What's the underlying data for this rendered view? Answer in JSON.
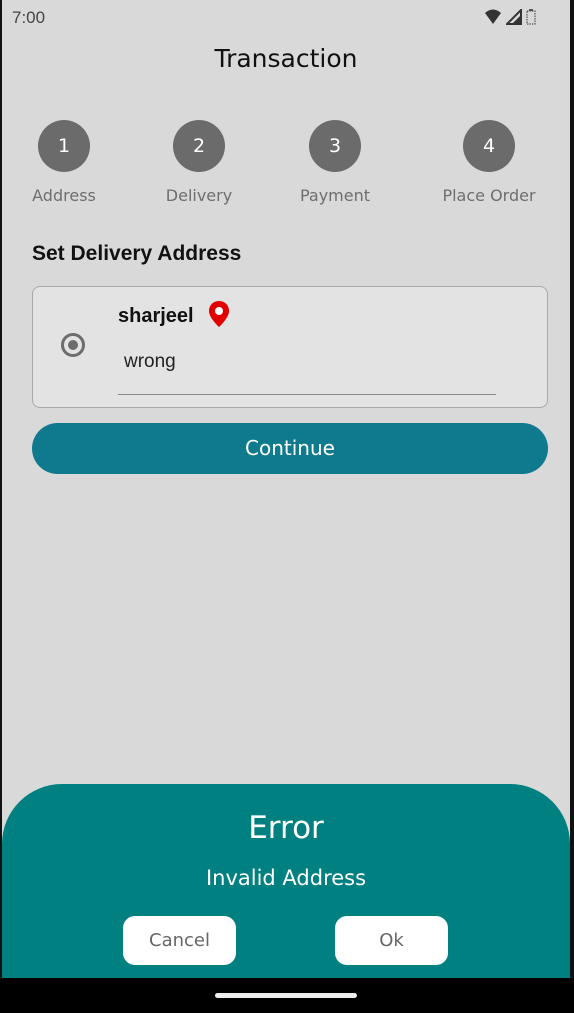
{
  "status": {
    "time": "7:00",
    "icons": [
      "wifi-icon",
      "signal-icon",
      "battery-icon"
    ]
  },
  "page": {
    "title": "Transaction"
  },
  "steps": [
    {
      "number": "1",
      "label": "Address"
    },
    {
      "number": "2",
      "label": "Delivery"
    },
    {
      "number": "3",
      "label": "Payment"
    },
    {
      "number": "4",
      "label": "Place  Order"
    }
  ],
  "address_section": {
    "title": "Set Delivery Address",
    "name": "sharjeel",
    "pin_icon": "location-pin-icon",
    "pin_color": "#e00000",
    "address_value": "wrong"
  },
  "actions": {
    "continue_label": "Continue"
  },
  "dialog": {
    "title": "Error",
    "message": "Invalid  Address",
    "cancel_label": "Cancel",
    "ok_label": "Ok"
  },
  "colors": {
    "accent": "#0f7a8e",
    "dialog_background": "#008080",
    "step_circle": "#6b6b6b"
  }
}
